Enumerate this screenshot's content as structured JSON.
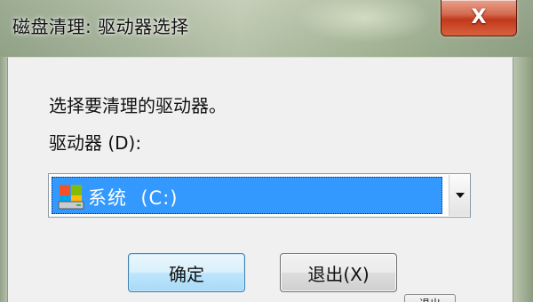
{
  "window": {
    "title": "磁盘清理: 驱动器选择",
    "close_glyph": "X"
  },
  "dialog": {
    "prompt": "选择要清理的驱动器。",
    "drive_label": "驱动器 (D):",
    "selected_drive": "系统  (C:)",
    "drive_icon": "windows-drive-icon",
    "ok_label": "确定",
    "cancel_label": "退出(X)",
    "partial_button_label": "退出"
  },
  "colors": {
    "selection": "#3399ff",
    "ok_border": "#3c7fb1",
    "close_red": "#c0391c"
  }
}
